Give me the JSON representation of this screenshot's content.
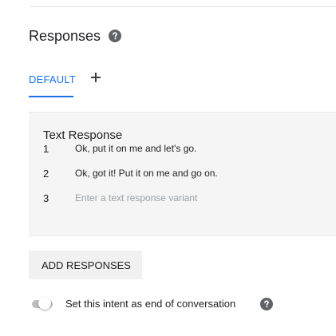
{
  "responses_section": {
    "title": "Responses"
  },
  "tabs": {
    "default_label": "DEFAULT",
    "add_icon": "plus-icon"
  },
  "text_response_card": {
    "title": "Text Response",
    "rows": [
      {
        "index": "1",
        "text": "Ok, put it on me and let's go."
      },
      {
        "index": "2",
        "text": "Ok, got it! Put it on me and go on."
      },
      {
        "index": "3",
        "text": "",
        "placeholder": "Enter a text response variant"
      }
    ]
  },
  "actions": {
    "add_responses_label": "ADD RESPONSES"
  },
  "end_conversation": {
    "label": "Set this intent as end of conversation",
    "toggle_on": false,
    "help_icon": "help-circle-icon"
  },
  "colors": {
    "accent": "#1a73e8",
    "card_bg": "#f5f5f5",
    "icon": "#5f6368"
  }
}
